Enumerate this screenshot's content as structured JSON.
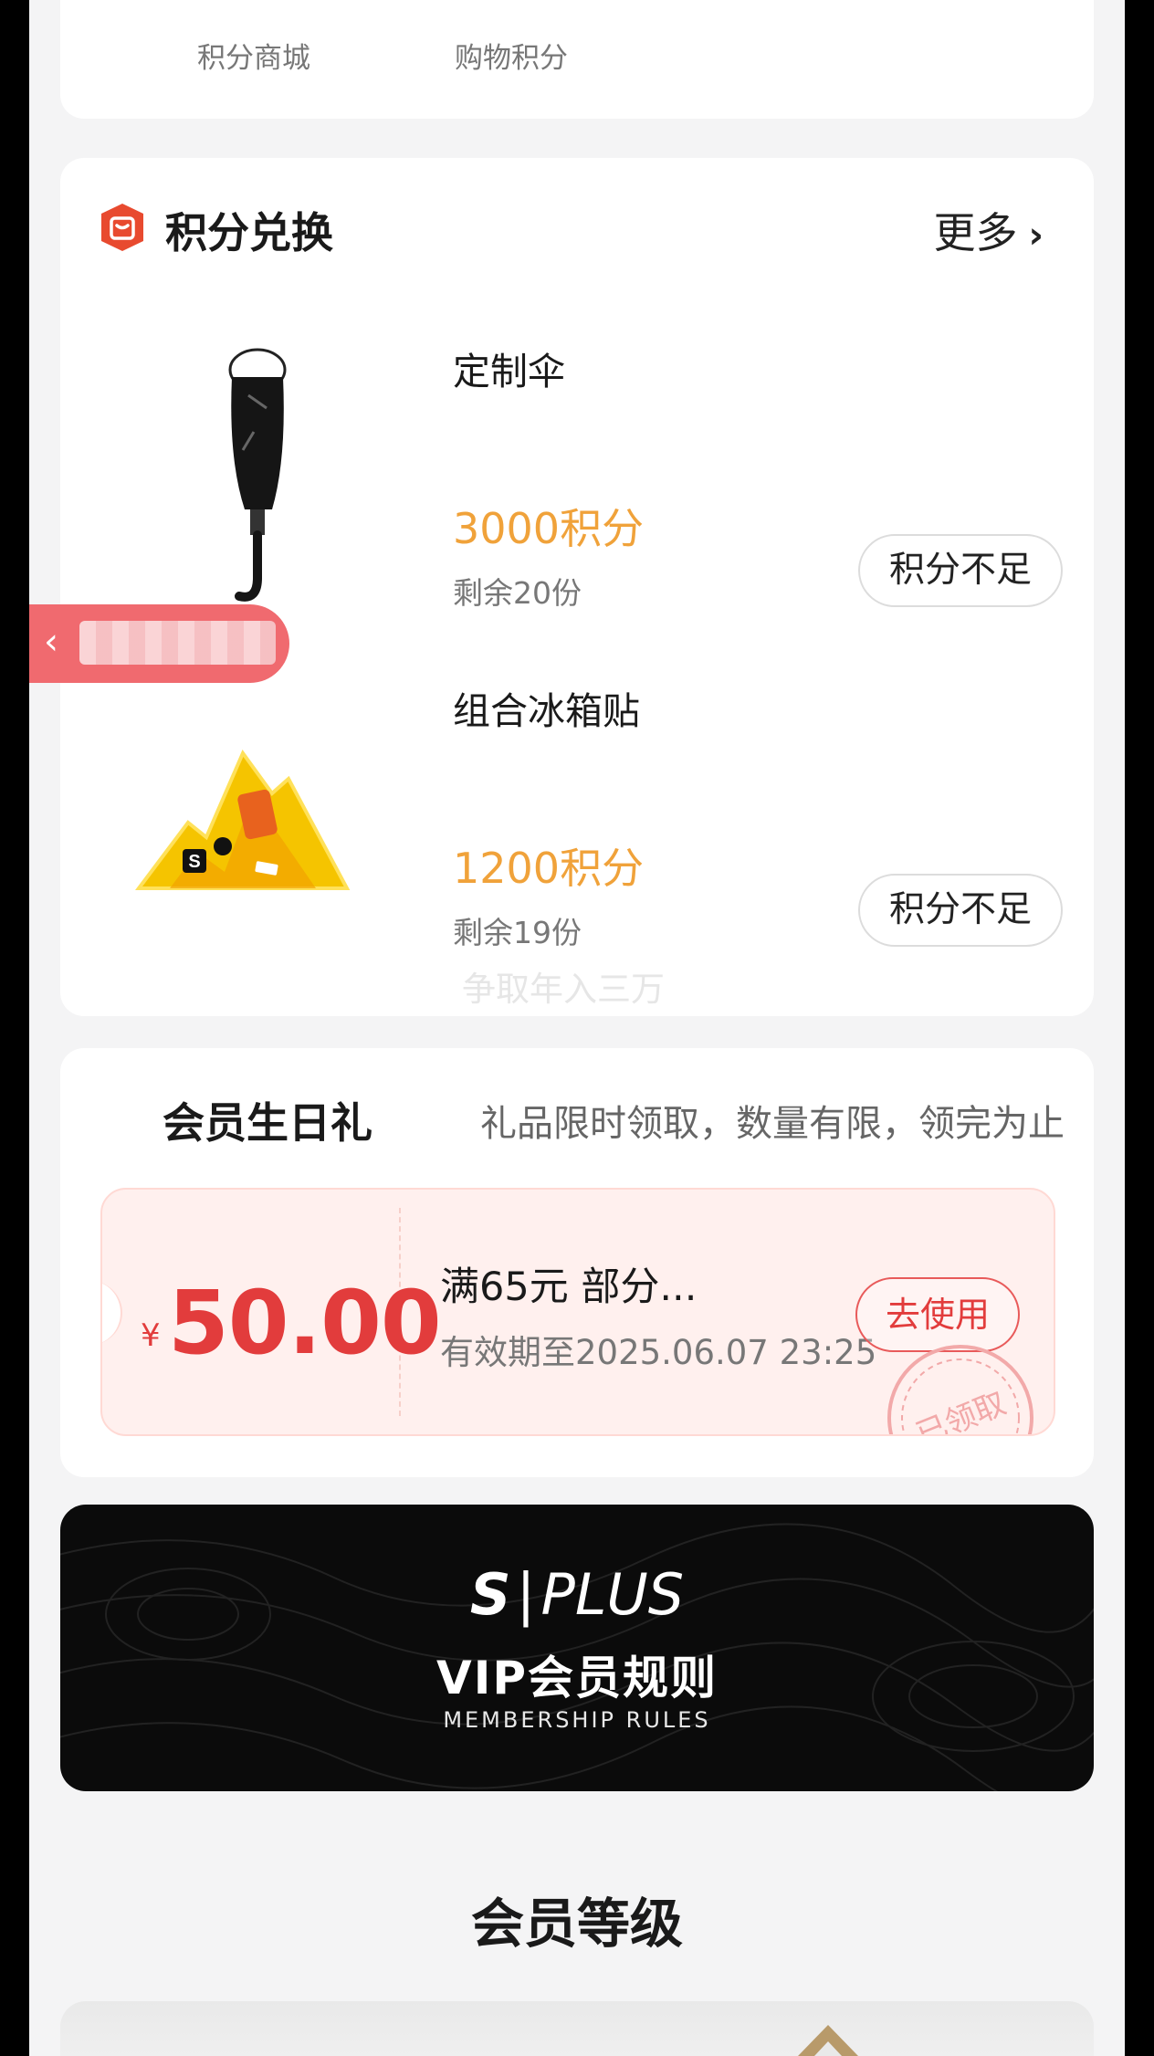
{
  "shortcuts": [
    {
      "label": "积分商城",
      "color": "#e8c48a"
    },
    {
      "label": "购物积分",
      "color": "#f5a05c"
    }
  ],
  "exchange": {
    "title": "积分兑换",
    "more": "更多",
    "icon": "gift-box-icon",
    "products": [
      {
        "name": "定制伞",
        "price": "3000积分",
        "stock": "剩余20份",
        "button": "积分不足"
      },
      {
        "name": "组合冰箱贴",
        "price": "1200积分",
        "stock": "剩余19份",
        "button": "积分不足"
      }
    ],
    "watermark": "争取年入三万"
  },
  "birthday": {
    "title": "会员生日礼",
    "subtitle": "礼品限时领取，数量有限，领完为止",
    "coupon": {
      "currency": "¥",
      "amount": "50.00",
      "name": "满65元 部分...",
      "validity": "有效期至2025.06.07 23:25",
      "button": "去使用",
      "stamp": "已领取"
    }
  },
  "vip": {
    "logo_s": "S",
    "logo_text": "PLUS",
    "title": "VIP会员规则",
    "subtitle": "MEMBERSHIP RULES"
  },
  "level": {
    "title": "会员等级"
  },
  "colors": {
    "accent_price": "#f0a23a",
    "coupon_red": "#e23c3c",
    "back_tab": "#f06a6f"
  }
}
